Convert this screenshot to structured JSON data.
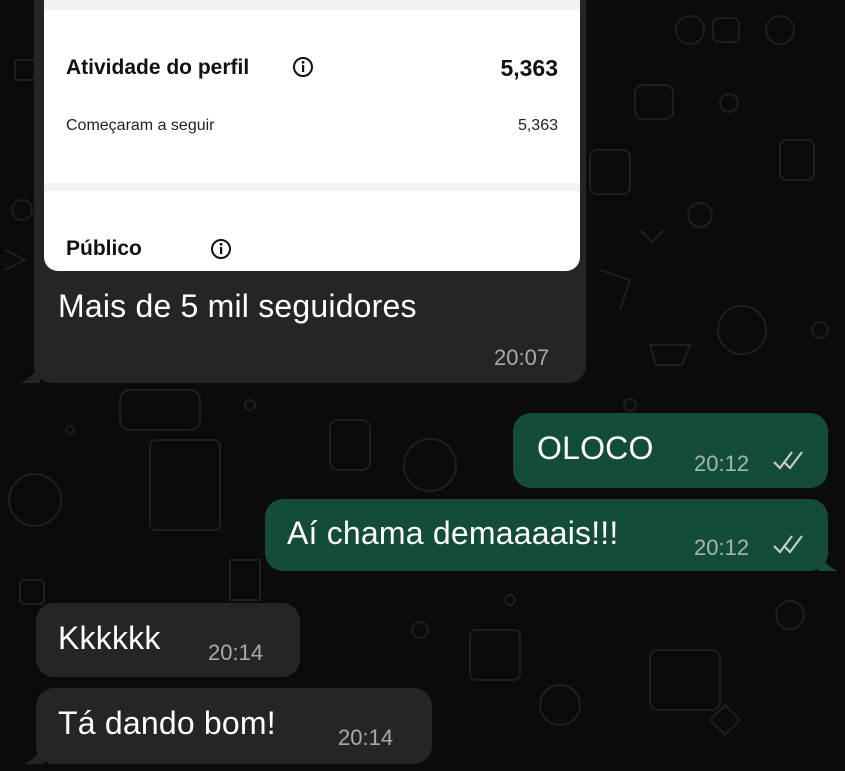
{
  "colors": {
    "background": "#0b0b0b",
    "incoming_bubble": "#242626",
    "outgoing_bubble": "#144d37",
    "read_ticks": "#c8ccc9"
  },
  "shared_card": {
    "profile_activity_label": "Atividade do perfil",
    "profile_activity_value": "5,363",
    "started_following_label": "Começaram a seguir",
    "started_following_value": "5,363",
    "audience_label": "Público",
    "info_icon": "info-circle-icon"
  },
  "messages": [
    {
      "direction": "incoming",
      "text": "Mais de 5 mil seguidores",
      "time": "20:07"
    },
    {
      "direction": "outgoing",
      "text": "OLOCO",
      "time": "20:12",
      "status": "read-double-check-icon"
    },
    {
      "direction": "outgoing",
      "text": "Aí chama demaaaais!!!",
      "time": "20:12",
      "status": "read-double-check-icon"
    },
    {
      "direction": "incoming",
      "text": "Kkkkkk",
      "time": "20:14"
    },
    {
      "direction": "incoming",
      "text": "Tá dando bom!",
      "time": "20:14"
    }
  ]
}
